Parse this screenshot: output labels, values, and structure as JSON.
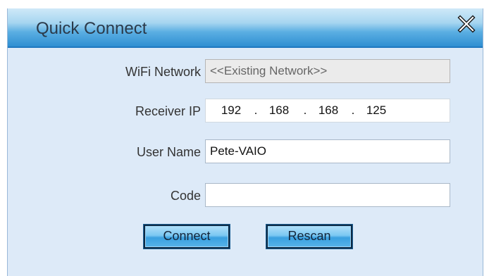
{
  "dialog": {
    "title": "Quick Connect",
    "close_icon": "close-x-icon"
  },
  "form": {
    "wifi_network": {
      "label": "WiFi Network",
      "value": "<<Existing Network>>"
    },
    "receiver_ip": {
      "label": "Receiver IP",
      "octets": [
        "192",
        "168",
        "168",
        "125"
      ],
      "separator": "."
    },
    "user_name": {
      "label": "User Name",
      "value": "Pete-VAIO"
    },
    "code": {
      "label": "Code",
      "value": ""
    }
  },
  "buttons": {
    "connect_label": "Connect",
    "rescan_label": "Rescan"
  },
  "colors": {
    "dialog_bg": "#ddeaf8",
    "titlebar_accent": "#2f8fd2",
    "button_accent": "#3aa0e0"
  }
}
